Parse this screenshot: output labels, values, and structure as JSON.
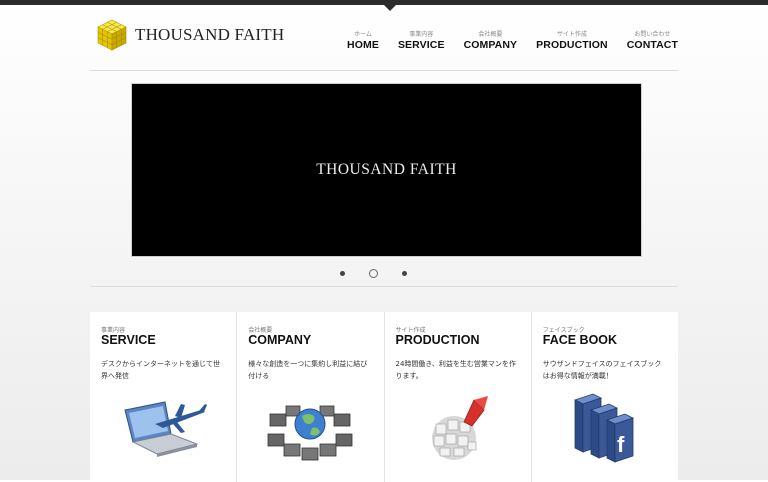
{
  "brand": {
    "name": "THOUSAND FAITH"
  },
  "nav": [
    {
      "sub": "ホーム",
      "label": "HOME"
    },
    {
      "sub": "事業内容",
      "label": "SERVICE"
    },
    {
      "sub": "会社概要",
      "label": "COMPANY"
    },
    {
      "sub": "サイト作成",
      "label": "PRODUCTION"
    },
    {
      "sub": "お問い合わせ",
      "label": "CONTACT"
    }
  ],
  "hero": {
    "title": "THOUSAND FAITH"
  },
  "slider": {
    "count": 3,
    "active": 2
  },
  "cards": [
    {
      "sub": "事業内容",
      "title": "SERVICE",
      "desc": "デスクからインターネットを通じて世界へ発信",
      "icon": "laptop-airplane-icon"
    },
    {
      "sub": "会社概要",
      "title": "COMPANY",
      "desc": "様々な創造を一つに集約し利益に結び付ける",
      "icon": "globe-network-icon"
    },
    {
      "sub": "サイト作成",
      "title": "PRODUCTION",
      "desc": "24時間働き、利益を生む営業マンを作ります。",
      "icon": "cube-sphere-arrow-icon"
    },
    {
      "sub": "フェイスブック",
      "title": "FACE BOOK",
      "desc": "サウザンドフェイスのフェイスブックはお得な情報が満載！",
      "icon": "facebook-cubes-icon"
    }
  ],
  "colors": {
    "topbar": "#2b2b2b",
    "logo": "#e8d000",
    "hero_bg": "#000000",
    "facebook": "#3b5998"
  }
}
